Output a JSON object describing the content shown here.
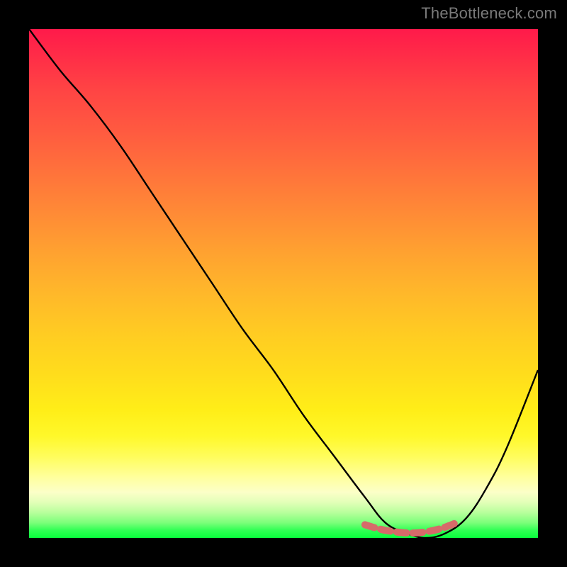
{
  "attribution": "TheBottleneck.com",
  "chart_data": {
    "type": "line",
    "title": "",
    "xlabel": "",
    "ylabel": "",
    "xlim": [
      0,
      100
    ],
    "ylim": [
      0,
      100
    ],
    "series": [
      {
        "name": "bottleneck-curve",
        "x": [
          0,
          6,
          12,
          18,
          24,
          30,
          36,
          42,
          48,
          54,
          60,
          66,
          70,
          74,
          78,
          82,
          86,
          90,
          94,
          100
        ],
        "values": [
          100,
          92,
          85,
          77,
          68,
          59,
          50,
          41,
          33,
          24,
          16,
          8,
          3,
          1,
          0,
          1,
          4,
          10,
          18,
          33
        ]
      },
      {
        "name": "optimal-marker",
        "x": [
          66,
          68,
          70,
          72,
          74,
          76,
          78,
          80,
          82,
          84
        ],
        "values": [
          2.6,
          2.0,
          1.5,
          1.2,
          1.0,
          1.0,
          1.2,
          1.6,
          2.2,
          3.0
        ]
      }
    ],
    "background": {
      "type": "vertical-gradient",
      "stops": [
        {
          "pos": 0,
          "color": "#ff1a4a"
        },
        {
          "pos": 50,
          "color": "#ffb82a"
        },
        {
          "pos": 80,
          "color": "#fff82a"
        },
        {
          "pos": 100,
          "color": "#08ff3c"
        }
      ]
    },
    "colors": {
      "curve": "#000000",
      "marker": "#d66a6a",
      "frame": "#000000"
    }
  }
}
